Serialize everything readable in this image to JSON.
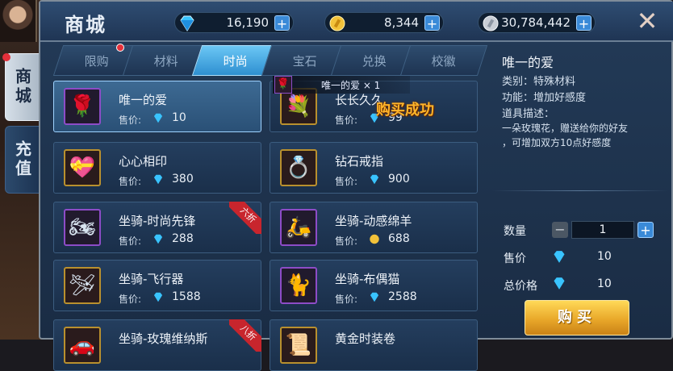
{
  "sidebar": {
    "tabs": [
      {
        "label": "商城"
      },
      {
        "label": "充值"
      }
    ]
  },
  "header": {
    "title": "商城",
    "currencies": {
      "diamond": "16,190",
      "gold": "8,344",
      "silver": "30,784,442"
    },
    "close_icon": "close-icon"
  },
  "tabs": [
    {
      "label": "限购"
    },
    {
      "label": "材料"
    },
    {
      "label": "时尚"
    },
    {
      "label": "宝石"
    },
    {
      "label": "兑换"
    },
    {
      "label": "校徽"
    }
  ],
  "items": [
    {
      "name": "唯一的爱",
      "price_label": "售价:",
      "price": "10",
      "currency": "diamond",
      "icon": "rose"
    },
    {
      "name": "长长久久",
      "price_label": "售价:",
      "price": "99",
      "currency": "diamond",
      "icon": "rose-bouquet"
    },
    {
      "name": "心心相印",
      "price_label": "售价:",
      "price": "380",
      "currency": "diamond",
      "icon": "heart-box"
    },
    {
      "name": "钻石戒指",
      "price_label": "售价:",
      "price": "900",
      "currency": "diamond",
      "icon": "ring"
    },
    {
      "name": "坐骑-时尚先锋",
      "price_label": "售价:",
      "price": "288",
      "currency": "diamond",
      "icon": "motorcycle",
      "badge": "六折"
    },
    {
      "name": "坐骑-动感绵羊",
      "price_label": "售价:",
      "price": "688",
      "currency": "gold",
      "icon": "scooter"
    },
    {
      "name": "坐骑-飞行器",
      "price_label": "售价:",
      "price": "1588",
      "currency": "diamond",
      "icon": "aircraft"
    },
    {
      "name": "坐骑-布偶猫",
      "price_label": "售价:",
      "price": "2588",
      "currency": "diamond",
      "icon": "cat"
    },
    {
      "name": "坐骑-玫瑰维纳斯",
      "price_label": "",
      "price": "",
      "currency": "diamond",
      "icon": "car",
      "badge": "八折"
    },
    {
      "name": "黄金时装卷",
      "price_label": "",
      "price": "",
      "currency": "diamond",
      "icon": "scroll"
    }
  ],
  "toast": {
    "item_text": "唯一的爱 × 1",
    "success_text": "购买成功"
  },
  "detail": {
    "name": "唯一的爱",
    "category": "类别：特殊材料",
    "function": "功能：增加好感度",
    "desc_title": "道具描述：",
    "desc_lines": [
      "一朵玫瑰花，赠送给你的好友",
      "，可增加双方10点好感度"
    ],
    "qty_label": "数量",
    "qty_value": "1",
    "minus": "−",
    "plus": "+",
    "unit_price_label": "售价",
    "unit_price": "10",
    "total_label": "总价格",
    "total_price": "10",
    "buy_label": "购买"
  },
  "colors": {
    "accent_blue": "#3a8ad8",
    "buy_gold": "#e9a82a",
    "badge_red": "#c8252d",
    "success_orange": "#ffb52a"
  }
}
